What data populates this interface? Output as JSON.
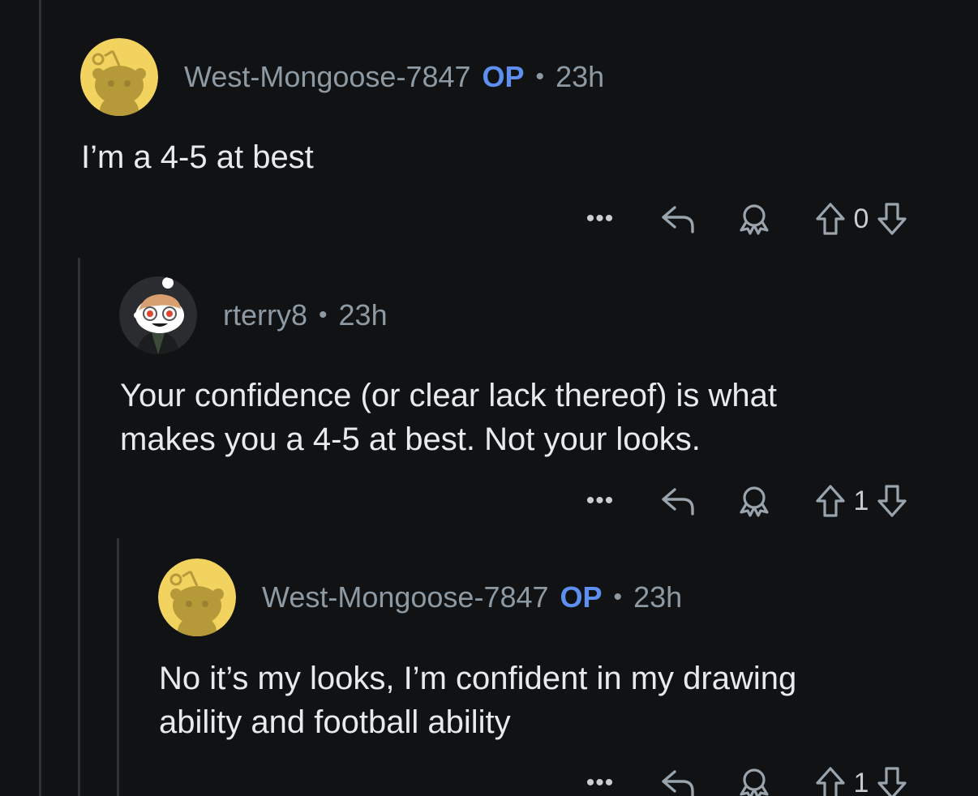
{
  "comments": [
    {
      "username": "West-Mongoose-7847",
      "op_label": "OP",
      "separator": "•",
      "time": "23h",
      "body": "I’m a 4-5 at best",
      "avatar": "snoo-yellow-avatar",
      "actions": {
        "more": "•••",
        "votes": "0"
      }
    },
    {
      "username": "rterry8",
      "op_label": "",
      "separator": "•",
      "time": "23h",
      "body": "Your confidence (or clear lack thereof) is what\nmakes you a 4-5 at best. Not your looks.",
      "avatar": "snoo-glasses-avatar",
      "actions": {
        "more": "•••",
        "votes": "1"
      }
    },
    {
      "username": "West-Mongoose-7847",
      "op_label": "OP",
      "separator": "•",
      "time": "23h",
      "body": "No it’s my looks, I’m confident in my drawing\nability and football ability",
      "avatar": "snoo-yellow-avatar",
      "actions": {
        "more": "•••",
        "votes": "1"
      }
    }
  ],
  "colors": {
    "background": "#111214",
    "thread_line": "#2e3236",
    "meta_text": "#8e9aa3",
    "op_badge": "#5e8ff0",
    "body_text": "#e8eaec",
    "icon": "#9aa4ac"
  },
  "icons": [
    "more-icon",
    "reply-icon",
    "award-icon",
    "upvote-icon",
    "downvote-icon"
  ]
}
